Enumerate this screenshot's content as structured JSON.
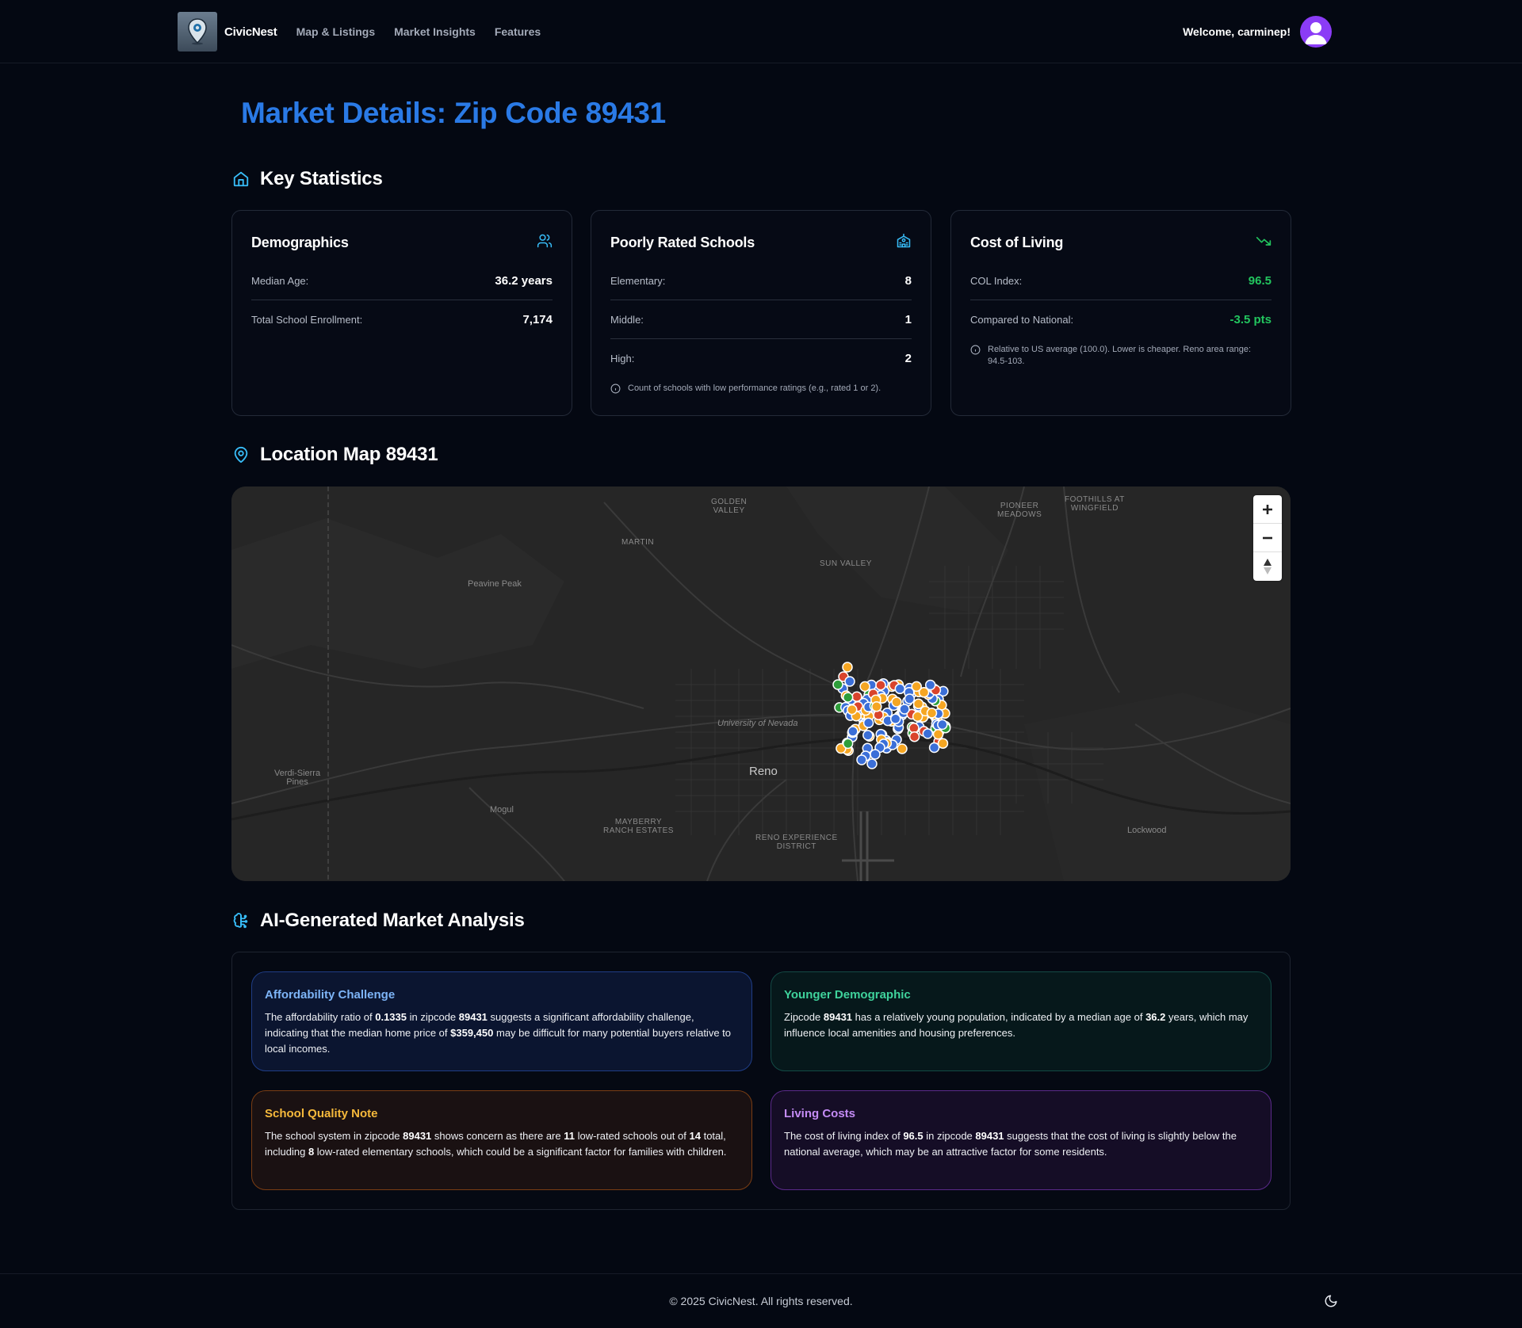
{
  "nav": {
    "brand": "CivicNest",
    "links": [
      "Map & Listings",
      "Market Insights",
      "Features"
    ],
    "welcome": "Welcome, carminep!"
  },
  "page": {
    "title": "Market Details: Zip Code 89431"
  },
  "sections": {
    "key_statistics": "Key Statistics",
    "location_map": "Location Map 89431",
    "ai_analysis": "AI-Generated Market Analysis"
  },
  "demographics": {
    "title": "Demographics",
    "median_age_label": "Median Age:",
    "median_age_value": "36.2 years",
    "enrollment_label": "Total School Enrollment:",
    "enrollment_value": "7,174"
  },
  "schools": {
    "title": "Poorly Rated Schools",
    "elementary_label": "Elementary:",
    "elementary_value": "8",
    "middle_label": "Middle:",
    "middle_value": "1",
    "high_label": "High:",
    "high_value": "2",
    "note": "Count of schools with low performance ratings (e.g., rated 1 or 2)."
  },
  "cost_of_living": {
    "title": "Cost of Living",
    "index_label": "COL Index:",
    "index_value": "96.5",
    "national_label": "Compared to National:",
    "national_value": "-3.5 pts",
    "note": "Relative to US average (100.0). Lower is cheaper. Reno area range: 94.5-103."
  },
  "map": {
    "labels": {
      "golden_valley": "GOLDEN\nVALLEY",
      "pioneer_meadows": "PIONEER\nMEADOWS",
      "foothills": "FOOTHILLS AT\nWINGFIELD",
      "martin": "MARTIN",
      "sun_valley": "SUN VALLEY",
      "peavine": "Peavine Peak",
      "university": "University of Nevada",
      "reno": "Reno",
      "verdi": "Verdi-Sierra\nPines",
      "mogul": "Mogul",
      "mayberry": "MAYBERRY\nRANCH ESTATES",
      "reno_experience": "RENO EXPERIENCE\nDISTRICT",
      "lockwood": "Lockwood"
    },
    "controls": {
      "zoom_in": "+",
      "zoom_out": "−",
      "compass": "▲"
    },
    "marker_colors": {
      "blue": "#3b6fd8",
      "orange": "#f5a623",
      "green": "#2e9e3a",
      "red": "#d9442c"
    }
  },
  "insights": {
    "affordability": {
      "title": "Affordability Challenge",
      "p1": "The affordability ratio of ",
      "ratio": "0.1335",
      "p2": " in zipcode ",
      "zip": "89431",
      "p3": " suggests a significant affordability challenge, indicating that the median home price of ",
      "price": "$359,450",
      "p4": " may be difficult for many potential buyers relative to local incomes."
    },
    "demographic": {
      "title": "Younger Demographic",
      "p1": "Zipcode ",
      "zip": "89431",
      "p2": " has a relatively young population, indicated by a median age of ",
      "age": "36.2",
      "p3": " years, which may influence local amenities and housing preferences."
    },
    "schools": {
      "title": "School Quality Note",
      "p1": "The school system in zipcode ",
      "zip": "89431",
      "p2": " shows concern as there are ",
      "low": "11",
      "p3": " low-rated schools out of ",
      "total": "14",
      "p4": " total, including ",
      "elem": "8",
      "p5": " low-rated elementary schools, which could be a significant factor for families with children."
    },
    "living": {
      "title": "Living Costs",
      "p1": "The cost of living index of ",
      "index": "96.5",
      "p2": " in zipcode ",
      "zip": "89431",
      "p3": " suggests that the cost of living is slightly below the national average, which may be an attractive factor for some residents."
    }
  },
  "footer": {
    "copyright": "© 2025 CivicNest. All rights reserved."
  },
  "colors": {
    "accent_blue": "#2a7ae6",
    "positive_green": "#22c55e",
    "icon_cyan": "#38bdf8"
  }
}
